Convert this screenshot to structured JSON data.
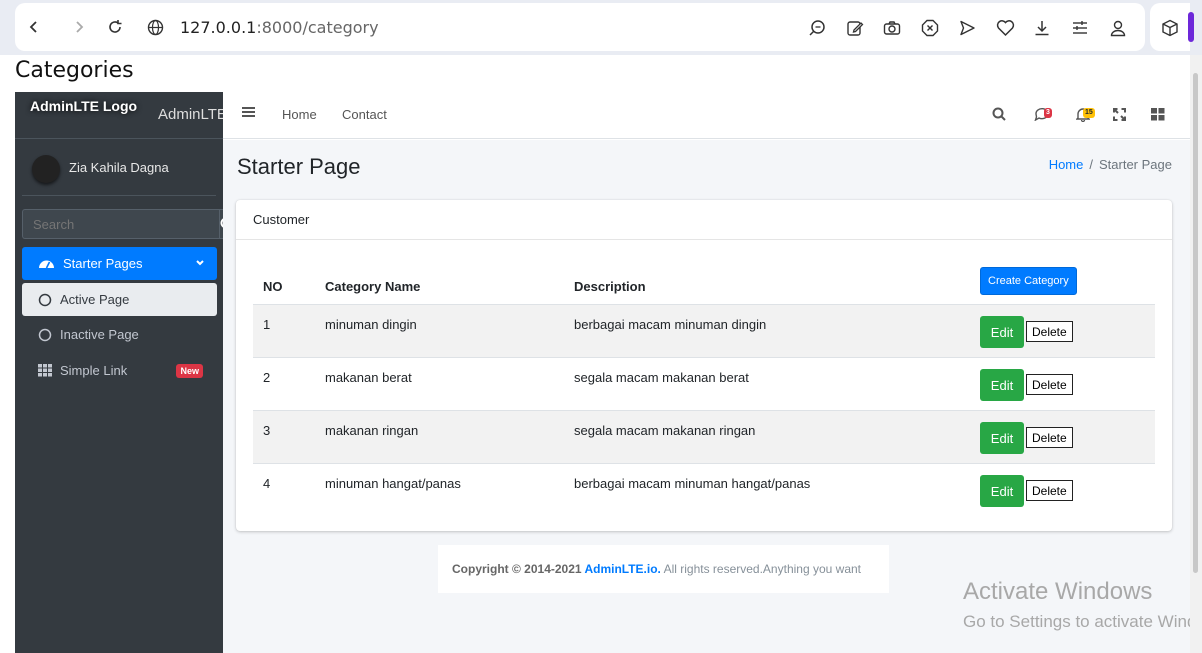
{
  "browser": {
    "url_host": "127.0.0.1",
    "url_path": ":8000/category"
  },
  "page": {
    "heading": "Categories"
  },
  "sidebar": {
    "brand_logo": "AdminLTE Logo",
    "brand_text": "AdminLTE",
    "user_name": "Zia Kahila Dagna",
    "search_placeholder": "Search",
    "menu": [
      {
        "label": "Starter Pages"
      },
      {
        "label": "Active Page"
      },
      {
        "label": "Inactive Page"
      },
      {
        "label": "Simple Link",
        "badge": "New"
      }
    ]
  },
  "navbar": {
    "links": [
      "Home",
      "Contact"
    ],
    "messages_count": "3",
    "notifications_count": "15"
  },
  "content": {
    "title": "Starter Page",
    "breadcrumb": {
      "home": "Home",
      "current": "Starter Page"
    },
    "card_title": "Customer",
    "table": {
      "headers": {
        "no": "NO",
        "name": "Category Name",
        "desc": "Description"
      },
      "create_label": "Create Category",
      "edit_label": "Edit",
      "delete_label": "Delete",
      "rows": [
        {
          "no": "1",
          "name": "minuman dingin",
          "desc": "berbagai macam minuman dingin"
        },
        {
          "no": "2",
          "name": "makanan berat",
          "desc": "segala macam makanan berat"
        },
        {
          "no": "3",
          "name": "makanan ringan",
          "desc": "segala macam makanan ringan"
        },
        {
          "no": "4",
          "name": "minuman hangat/panas",
          "desc": "berbagai macam minuman hangat/panas"
        }
      ]
    }
  },
  "footer": {
    "copyright": "Copyright © 2014-2021 ",
    "link": "AdminLTE.io.",
    "rest": " All rights reserved.Anything you want"
  },
  "watermark": {
    "title": "Activate Windows",
    "subtitle": "Go to Settings to activate Windows."
  }
}
